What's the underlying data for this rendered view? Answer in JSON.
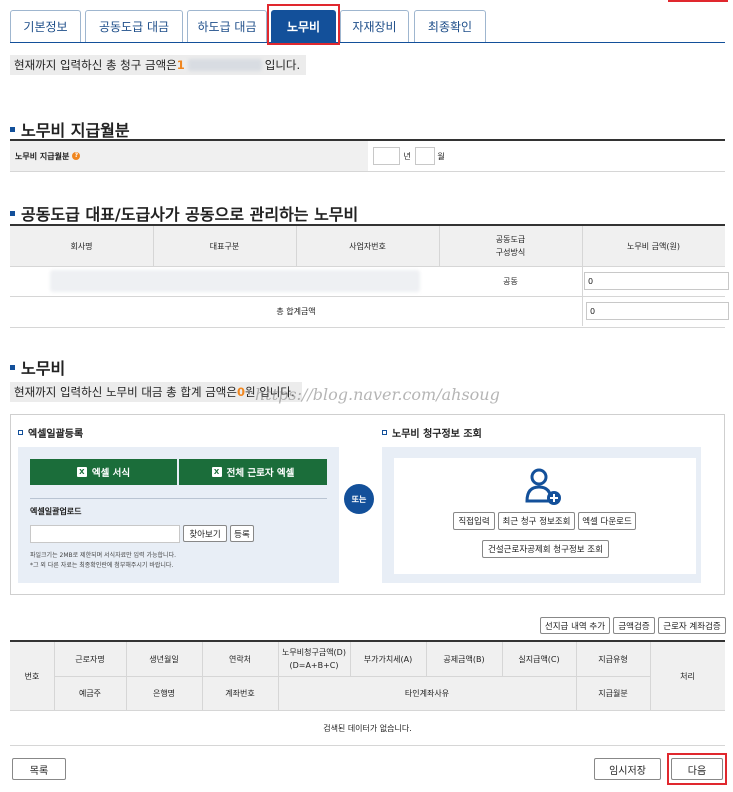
{
  "tabs": [
    {
      "label": "기본정보"
    },
    {
      "label": "공동도급 대금"
    },
    {
      "label": "하도급 대금"
    },
    {
      "label": "노무비"
    },
    {
      "label": "자재장비"
    },
    {
      "label": "최종확인"
    }
  ],
  "notice_total": {
    "prefix": "현재까지 입력하신 총 청구 금액은 ",
    "amount_first_digit": "1",
    "suffix": " 입니다."
  },
  "section1": {
    "title": "노무비 지급월분",
    "label": "노무비 지급월분",
    "year_unit": "년",
    "month_unit": "월"
  },
  "section2": {
    "title": "공동도급 대표/도급사가 공동으로 관리하는 노무비",
    "headers": [
      "회사명",
      "대표구분",
      "사업자번호",
      "공동도급\n구성방식",
      "노무비 금액(원)"
    ],
    "row": {
      "method": "공동",
      "amount": "0"
    },
    "total_label": "총 합계금액",
    "total_value": "0"
  },
  "section3": {
    "title": "노무비",
    "notice_prefix": "현재까지 입력하신 노무비 대금 총 합계 금액은 ",
    "notice_amount": "0",
    "notice_suffix": "원 입니다.",
    "watermark": "https://blog.naver.com/ahsoug",
    "excel_box_title": "엑셀일괄등록",
    "excel_form_btn": "엑셀 서식",
    "all_workers_excel_btn": "전체 근로자 엑셀",
    "upload_label": "엑셀일괄업로드",
    "browse_btn": "찾아보기",
    "register_btn": "등록",
    "note1": "파일크기는 2MB로 제한되며 서식자료만 입력 가능합니다.",
    "note2": "*그 외 다른 자료는 최종확인란에 첨부해주시기 바랍니다.",
    "or_label": "또는",
    "claim_box_title": "노무비 청구정보 조회",
    "direct_input_btn": "직접입력",
    "recent_claim_btn": "최근 청구 정보조회",
    "excel_download_btn": "엑셀 다운로드",
    "construction_mutual_btn": "건설근로자공제회 청구정보 조회"
  },
  "table_actions": [
    "선지급 내역 추가",
    "금액검증",
    "근로자 계좌검증"
  ],
  "worker_table": {
    "no_header": "번호",
    "row1": [
      "근로자명",
      "생년월일",
      "연락처",
      "노무비청구금액(D)\n(D=A+B+C)",
      "부가가치세(A)",
      "공제금액(B)",
      "실지급액(C)",
      "지급유형"
    ],
    "row2": [
      "예금주",
      "은행명",
      "계좌번호",
      "타인계좌사유",
      "지급월분"
    ],
    "process_header": "처리",
    "empty_message": "검색된 데이터가 없습니다."
  },
  "footer": {
    "list_btn": "목록",
    "temp_save_btn": "임시저장",
    "next_btn": "다음"
  },
  "colors": {
    "primary": "#13509a",
    "accent": "#f0861f",
    "excel_green": "#1b6d3a",
    "highlight_red": "#e0282e"
  }
}
